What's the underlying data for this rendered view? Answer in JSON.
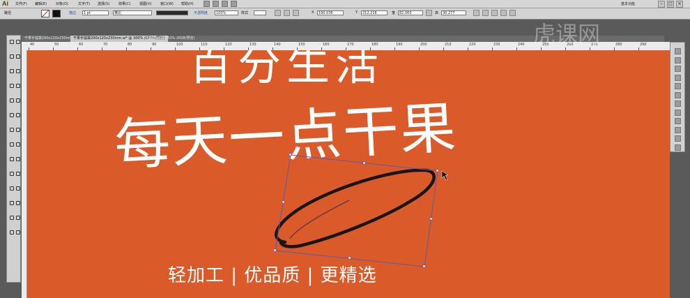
{
  "app": {
    "logo": "Ai"
  },
  "menu": [
    "文件(F)",
    "编辑(E)",
    "对象(O)",
    "文字(T)",
    "选择(S)",
    "效果(C)",
    "视图(V)",
    "窗口(W)",
    "帮助(H)"
  ],
  "workspace": "基本功能",
  "control": {
    "path_label": "路径",
    "stroke_label": "描边",
    "stroke_width": "1 pt",
    "profile": "等比",
    "opacity_label": "不透明度",
    "opacity_value": "100%",
    "style_label": "样式",
    "x_label": "X",
    "x_value": "190.036",
    "y_label": "Y",
    "y_value": "212.216",
    "w_label": "宽",
    "w_value": "82.063",
    "h_label": "高",
    "h_value": "30.277"
  },
  "tabs": [
    {
      "label": "干果手提袋290x120x230mm.ai* @ 300% (CMYK/预览)",
      "active": false
    },
    {
      "label": "干果手提袋290x120x230mm.ai* @ 300% (CMYK/预览)",
      "active": true
    },
    {
      "label": "素材.ai @ 150% (RGB/预览)",
      "active": false
    }
  ],
  "ruler": [
    "40",
    "50",
    "60",
    "70",
    "80",
    "90",
    "100",
    "110",
    "120",
    "130",
    "140",
    "150",
    "160",
    "170",
    "180",
    "190",
    "200",
    "210",
    "220",
    "230",
    "240",
    "250",
    "260",
    "270",
    "280",
    "290"
  ],
  "artwork": {
    "line1": "百分生活",
    "line2": "每天一点干果",
    "tagline": "轻加工 | 优品质 | 更精选"
  },
  "watermark": "虎课网",
  "colors": {
    "canvas_bg": "#db5a2a",
    "text": "#ffffff",
    "selection": "#4a5ab0"
  }
}
